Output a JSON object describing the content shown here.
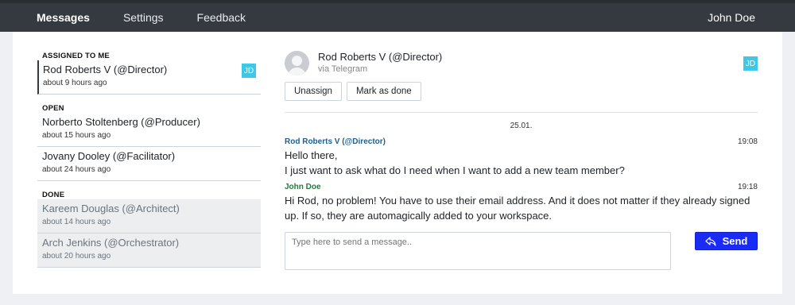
{
  "navbar": {
    "items": [
      {
        "label": "Messages",
        "active": true
      },
      {
        "label": "Settings",
        "active": false
      },
      {
        "label": "Feedback",
        "active": false
      }
    ],
    "user": "John Doe"
  },
  "sidebar": {
    "sections": [
      {
        "title": "ASSIGNED TO ME",
        "items": [
          {
            "name": "Rod Roberts V (@Director)",
            "time": "about 9 hours ago",
            "badge": "JD"
          }
        ]
      },
      {
        "title": "OPEN",
        "items": [
          {
            "name": "Norberto Stoltenberg (@Producer)",
            "time": "about 15 hours ago"
          },
          {
            "name": "Jovany Dooley (@Facilitator)",
            "time": "about 24 hours ago"
          }
        ]
      },
      {
        "title": "DONE",
        "items": [
          {
            "name": "Kareem Douglas (@Architect)",
            "time": "about 14 hours ago"
          },
          {
            "name": "Arch Jenkins (@Orchestrator)",
            "time": "about 20 hours ago"
          }
        ]
      }
    ]
  },
  "conversation": {
    "contact_name": "Rod Roberts V (@Director)",
    "channel": "via Telegram",
    "badge": "JD",
    "actions": {
      "unassign": "Unassign",
      "mark_done": "Mark as done"
    },
    "date": "25.01.",
    "messages": [
      {
        "author": "Rod Roberts V (@Director)",
        "time": "19:08",
        "lines": [
          "Hello there,",
          "I just want to ask what do I need when I want to add a new team member?"
        ]
      },
      {
        "author": "John Doe",
        "time": "19:18",
        "lines": [
          "Hi Rod, no problem! You have to use their email address. And it does not matter if they already signed",
          "up. If so, they are automagically added to your workspace."
        ]
      }
    ],
    "compose": {
      "placeholder": "Type here to send a message..",
      "send_label": "Send"
    }
  },
  "colors": {
    "navbar": "#343a40",
    "badge": "#3fc7e6",
    "send": "#1a2bf5",
    "author_contact": "#1f5f8b",
    "author_agent": "#1e7d3a"
  },
  "icons": {
    "send": "reply-arrow-icon",
    "avatar": "user-avatar-icon"
  }
}
